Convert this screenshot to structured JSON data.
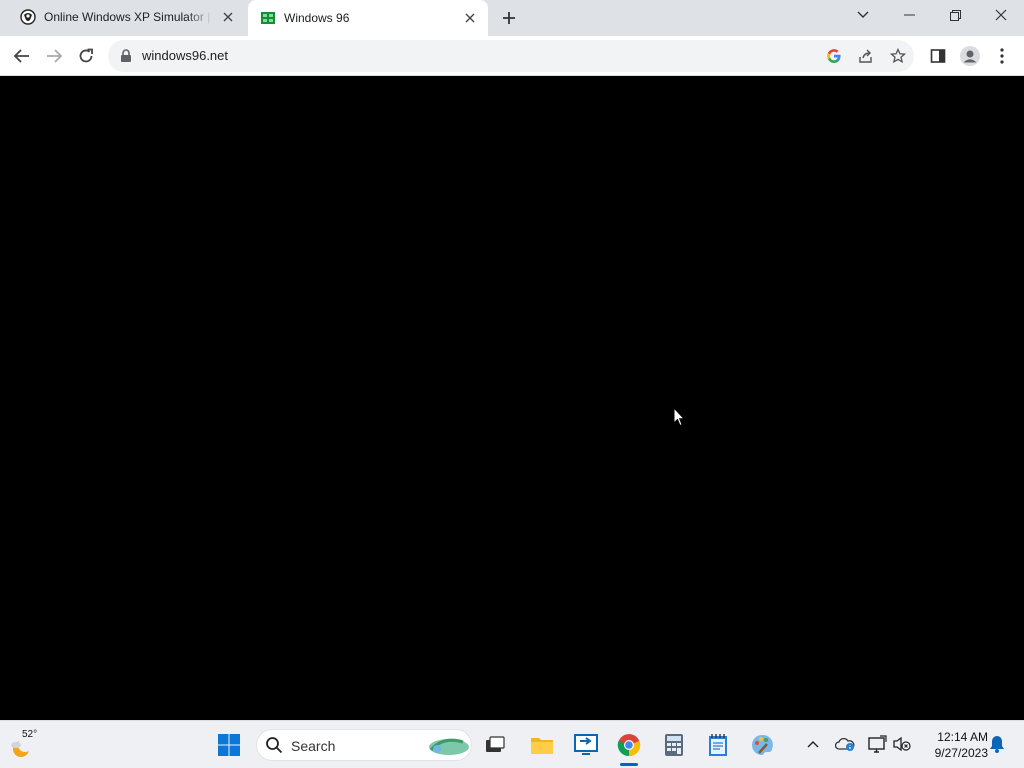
{
  "browser": {
    "tabs": [
      {
        "title": "Online Windows XP Simulator | ",
        "icon": "xp-simulator-favicon-icon",
        "active": false
      },
      {
        "title": "Windows 96",
        "icon": "windows96-favicon-icon",
        "active": true
      }
    ],
    "url": "windows96.net",
    "accent": "#0067c0"
  },
  "page": {
    "background": "#000000"
  },
  "taskbar": {
    "weather_temp": "52°",
    "search_label": "Search",
    "time": "12:14 AM",
    "date": "9/27/2023",
    "pinned": [
      "file-explorer-icon",
      "remote-desktop-icon",
      "chrome-icon",
      "calculator-icon",
      "notepad-icon",
      "paint-icon"
    ]
  }
}
